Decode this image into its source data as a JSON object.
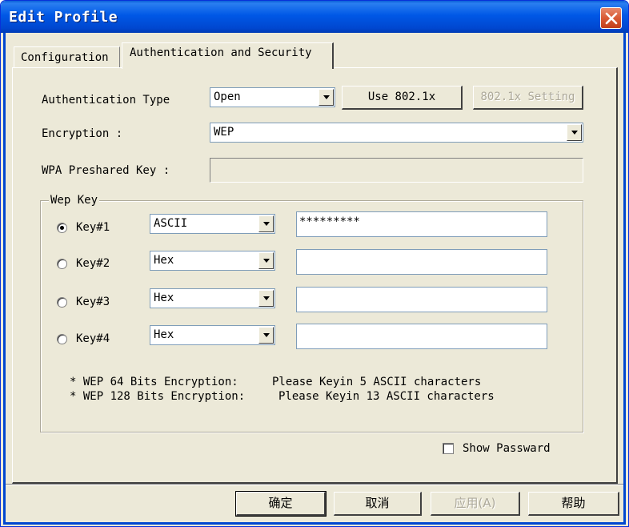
{
  "window": {
    "title": "Edit Profile"
  },
  "tabs": [
    {
      "label": "Configuration",
      "active": false
    },
    {
      "label": "Authentication and Security",
      "active": true
    }
  ],
  "auth": {
    "type_label": "Authentication Type",
    "type_value": "Open",
    "use_8021x_label": "Use 802.1x",
    "setting_8021x_label": "802.1x Setting",
    "encryption_label": "Encryption :",
    "encryption_value": "WEP",
    "wpa_label": "WPA Preshared Key :",
    "wpa_value": ""
  },
  "wep": {
    "group_title": "Wep Key",
    "keys": [
      {
        "label": "Key#1",
        "format": "ASCII",
        "value": "*********",
        "selected": true
      },
      {
        "label": "Key#2",
        "format": "Hex",
        "value": "",
        "selected": false
      },
      {
        "label": "Key#3",
        "format": "Hex",
        "value": "",
        "selected": false
      },
      {
        "label": "Key#4",
        "format": "Hex",
        "value": "",
        "selected": false
      }
    ],
    "notes": [
      {
        "name": "* WEP 64 Bits Encryption:",
        "text": "Please Keyin 5 ASCII characters"
      },
      {
        "name": "* WEP 128 Bits Encryption:",
        "text": "Please Keyin 13 ASCII characters"
      }
    ]
  },
  "show_password": {
    "label": "Show Passward",
    "checked": false
  },
  "footer": {
    "ok": "确定",
    "cancel": "取消",
    "apply": "应用(A)",
    "help": "帮助"
  }
}
